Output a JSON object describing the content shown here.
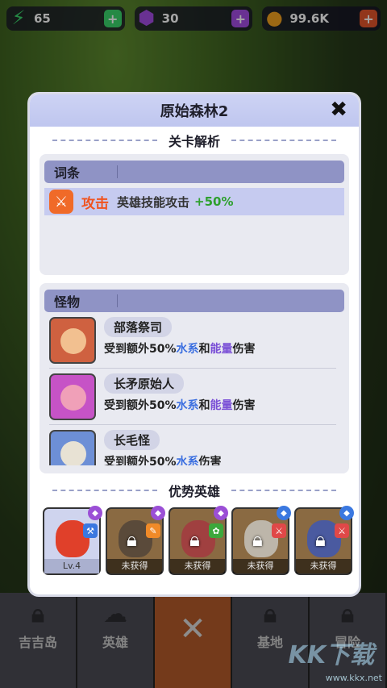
{
  "resources": [
    {
      "icon": "lightning-icon",
      "value": "65",
      "color": "#3ad36a"
    },
    {
      "icon": "gem-icon",
      "value": "30",
      "color": "#a24ce0"
    },
    {
      "icon": "coin-icon",
      "value": "99.6K",
      "color": "#f0a020"
    }
  ],
  "nav": {
    "items": [
      {
        "label": "吉吉岛",
        "icon": "lock-icon"
      },
      {
        "label": "英雄",
        "icon": "hero-icon"
      },
      {
        "label": "",
        "icon": "close-icon"
      },
      {
        "label": "基地",
        "icon": "lock-icon"
      },
      {
        "label": "冒险",
        "icon": "lock-icon"
      }
    ]
  },
  "watermark": {
    "text": "www.kkx.net",
    "logo": "KK下载"
  },
  "dialog": {
    "title": "原始森林2",
    "close_icon": "close-icon",
    "level_analysis": "关卡解析",
    "perks_header": "词条",
    "perk": {
      "name": "攻击",
      "desc": "英雄技能攻击",
      "value": "+50%",
      "icon": "sword-icon"
    },
    "monsters_header": "怪物",
    "monsters": [
      {
        "name": "部落祭司",
        "pre": "受到额外50%",
        "water": "水系",
        "mid": "和",
        "energy": "能量",
        "post": "伤害",
        "color": "#e06a4a"
      },
      {
        "name": "长矛原始人",
        "pre": "受到额外50%",
        "water": "水系",
        "mid": "和",
        "energy": "能量",
        "post": "伤害",
        "color": "#d55bd0"
      },
      {
        "name": "长毛怪",
        "pre": "受到额外50%",
        "water": "水系",
        "mid": "",
        "energy": "",
        "post": "伤害",
        "color": "#c9c0b0"
      }
    ],
    "advantage_heroes": "优势英雄",
    "heroes": [
      {
        "label": "Lv.4",
        "owned": true,
        "elem_color": "#9b4fd6",
        "role_color": "#3b78e0"
      },
      {
        "label": "未获得",
        "owned": false,
        "elem_color": "#9b4fd6",
        "role_color": "#f08a28"
      },
      {
        "label": "未获得",
        "owned": false,
        "elem_color": "#9b4fd6",
        "role_color": "#3ca83c"
      },
      {
        "label": "未获得",
        "owned": false,
        "elem_color": "#3b78e0",
        "role_color": "#e04848"
      },
      {
        "label": "未获得",
        "owned": false,
        "elem_color": "#3b78e0",
        "role_color": "#e04848"
      }
    ]
  }
}
